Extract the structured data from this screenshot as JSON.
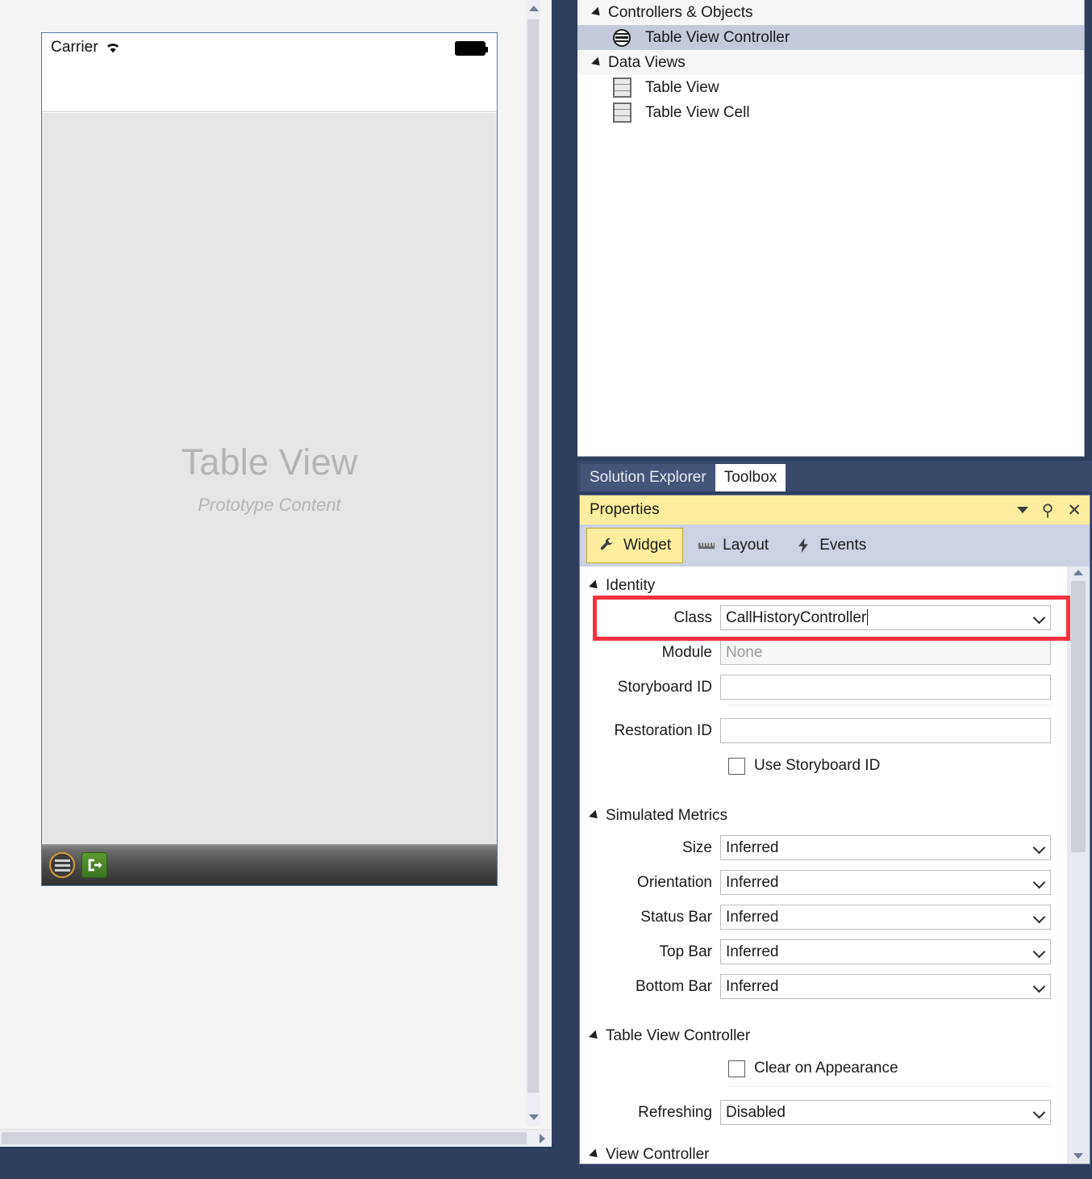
{
  "designer": {
    "device": {
      "carrier_label": "Carrier",
      "wifi_icon": "wifi-icon",
      "battery_icon": "battery-icon",
      "placeholder_title": "Table View",
      "placeholder_subtitle": "Prototype Content",
      "toolbar_icons": [
        "table-view-controller-icon",
        "exit-segue-icon"
      ]
    },
    "border_color": "#4a7ba6",
    "canvas_bg": "#e6e6e6"
  },
  "outline": {
    "groups": [
      {
        "label": "Controllers & Objects",
        "items": [
          {
            "label": "Table View Controller",
            "icon": "table-view-controller-icon",
            "selected": true
          }
        ]
      },
      {
        "label": "Data Views",
        "items": [
          {
            "label": "Table View",
            "icon": "table-view-icon",
            "selected": false
          },
          {
            "label": "Table View Cell",
            "icon": "table-view-cell-icon",
            "selected": false
          }
        ]
      }
    ]
  },
  "tabstrip": {
    "tabs": [
      {
        "label": "Solution Explorer",
        "active": false
      },
      {
        "label": "Toolbox",
        "active": true
      }
    ]
  },
  "properties": {
    "title": "Properties",
    "header_buttons": {
      "dropdown": "chevron-down-icon",
      "pin": "pin-icon",
      "close": "close-icon"
    },
    "tabs": [
      {
        "label": "Widget",
        "icon": "wrench-icon",
        "active": true
      },
      {
        "label": "Layout",
        "icon": "ruler-icon",
        "active": false
      },
      {
        "label": "Events",
        "icon": "lightning-bolt-icon",
        "active": false
      }
    ],
    "sections": [
      {
        "title": "Identity",
        "highlight_color": "#f5333f",
        "fields": [
          {
            "label": "Class",
            "type": "combo-editable",
            "value": "CallHistoryController",
            "placeholder": "",
            "highlighted": true,
            "focused": true
          },
          {
            "label": "Module",
            "type": "text",
            "value": "",
            "placeholder": "None",
            "disabled": true
          },
          {
            "label": "Storyboard ID",
            "type": "text",
            "value": "",
            "placeholder": ""
          },
          {
            "label": "Restoration ID",
            "type": "text",
            "value": "",
            "placeholder": ""
          }
        ],
        "checkboxes": [
          {
            "label": "Use Storyboard ID",
            "checked": false
          }
        ]
      },
      {
        "title": "Simulated Metrics",
        "fields": [
          {
            "label": "Size",
            "type": "combo",
            "value": "Inferred"
          },
          {
            "label": "Orientation",
            "type": "combo",
            "value": "Inferred"
          },
          {
            "label": "Status Bar",
            "type": "combo",
            "value": "Inferred"
          },
          {
            "label": "Top Bar",
            "type": "combo",
            "value": "Inferred"
          },
          {
            "label": "Bottom Bar",
            "type": "combo",
            "value": "Inferred"
          }
        ],
        "checkboxes": []
      },
      {
        "title": "Table View Controller",
        "checkboxes": [
          {
            "label": "Clear on Appearance",
            "checked": false
          }
        ],
        "fields": [
          {
            "label": "Refreshing",
            "type": "combo",
            "value": "Disabled"
          }
        ]
      },
      {
        "title": "View Controller",
        "cutoff": true,
        "fields": [],
        "checkboxes": []
      }
    ]
  }
}
